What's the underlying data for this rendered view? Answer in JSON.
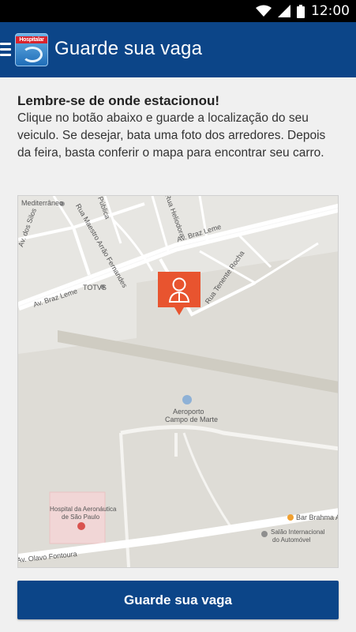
{
  "status_bar": {
    "time": "12:00",
    "icons": [
      "wifi-icon",
      "signal-icon",
      "battery-icon"
    ]
  },
  "app_bar": {
    "title": "Guarde sua vaga",
    "logo_text": "Hospitalar",
    "menu_icon": "hamburger-menu-icon"
  },
  "content": {
    "heading": "Lembre-se de onde estacionou!",
    "description": "Clique no botão abaixo e guarde a localização do seu veiculo. Se desejar, bata uma foto dos arredores. Depois da feira, basta conferir o mapa para encontrar seu carro."
  },
  "map": {
    "labels": {
      "mediterraneo": "Mediterrâneo",
      "dos_silos": "Av. dos Silos",
      "maestro": "Rua Maestro Arrão Fernandes",
      "heliodora": "Rua Heliodora",
      "braz_leme_top": "Av. Braz Leme",
      "braz_leme_left": "Av. Braz Leme",
      "totvs": "TOTVS",
      "tenente_rocha": "Rua Tenente Rocha",
      "aeroporto_1": "Aeroporto",
      "aeroporto_2": "Campo de Marte",
      "hospital_1": "Hospital da Aeronáutica",
      "hospital_2": "de São Paulo",
      "bar_brahma": "Bar Brahma Aeroporto",
      "salao_1": "Salão Internacional",
      "salao_2": "do Automóvel",
      "olavo": "Av. Olavo Fontoura",
      "publica": "Pública"
    },
    "marker_icon": "person-marker-icon",
    "colors": {
      "marker": "#e8542f",
      "road": "#ffffff",
      "land": "#e7e6e2",
      "area_gray": "#dcdbd6",
      "hospital": "#f3d6d6"
    }
  },
  "button": {
    "label": "Guarde sua vaga"
  },
  "colors": {
    "primary": "#0c4588",
    "background": "#f0f0f0"
  }
}
